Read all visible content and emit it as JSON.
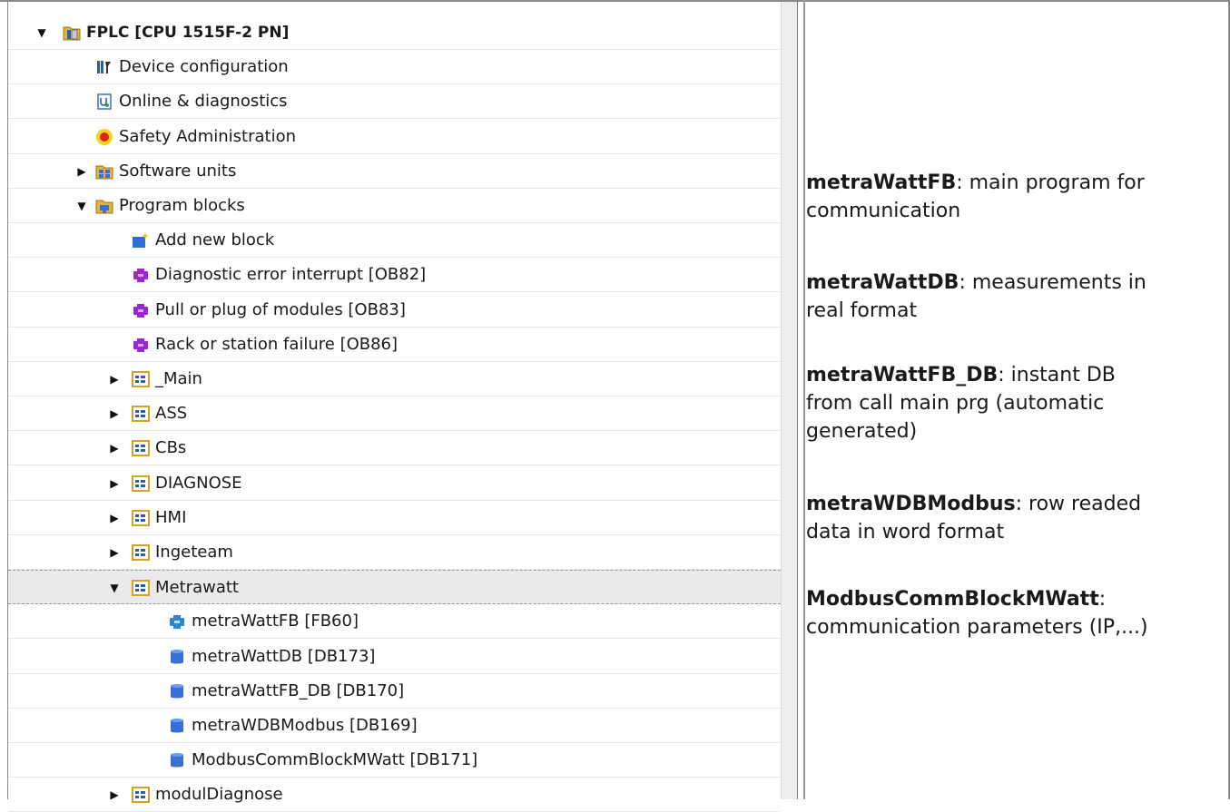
{
  "tree": {
    "items": [
      {
        "label": "FPLC [CPU 1515F-2 PN]",
        "icon": "plc-folder-icon",
        "arrow": "expanded"
      },
      {
        "label": "Device configuration",
        "icon": "device-configuration-icon",
        "arrow": "none"
      },
      {
        "label": "Online & diagnostics",
        "icon": "online-diagnostics-icon",
        "arrow": "none"
      },
      {
        "label": "Safety Administration",
        "icon": "safety-administration-icon",
        "arrow": "none"
      },
      {
        "label": "Software units",
        "icon": "software-units-icon",
        "arrow": "collapsed"
      },
      {
        "label": "Program blocks",
        "icon": "program-blocks-folder-icon",
        "arrow": "expanded"
      },
      {
        "label": "Add new block",
        "icon": "add-new-block-icon",
        "arrow": "none"
      },
      {
        "label": "Diagnostic error interrupt [OB82]",
        "icon": "ob-block-icon",
        "arrow": "none"
      },
      {
        "label": "Pull or plug of modules [OB83]",
        "icon": "ob-block-icon",
        "arrow": "none"
      },
      {
        "label": "Rack or station failure [OB86]",
        "icon": "ob-block-icon",
        "arrow": "none"
      },
      {
        "label": "_Main",
        "icon": "group-folder-icon",
        "arrow": "collapsed"
      },
      {
        "label": "ASS",
        "icon": "group-folder-icon",
        "arrow": "collapsed"
      },
      {
        "label": "CBs",
        "icon": "group-folder-icon",
        "arrow": "collapsed"
      },
      {
        "label": "DIAGNOSE",
        "icon": "group-folder-icon",
        "arrow": "collapsed"
      },
      {
        "label": "HMI",
        "icon": "group-folder-icon",
        "arrow": "collapsed"
      },
      {
        "label": "Ingeteam",
        "icon": "group-folder-icon",
        "arrow": "collapsed"
      },
      {
        "label": "Metrawatt",
        "icon": "group-folder-icon",
        "arrow": "expanded"
      },
      {
        "label": "metraWattFB [FB60]",
        "icon": "fb-block-icon",
        "arrow": "none"
      },
      {
        "label": "metraWattDB [DB173]",
        "icon": "db-block-icon",
        "arrow": "none"
      },
      {
        "label": "metraWattFB_DB [DB170]",
        "icon": "db-block-icon",
        "arrow": "none"
      },
      {
        "label": "metraWDBModbus [DB169]",
        "icon": "db-block-icon",
        "arrow": "none"
      },
      {
        "label": "ModbusCommBlockMWatt [DB171]",
        "icon": "db-block-icon",
        "arrow": "none"
      },
      {
        "label": "modulDiagnose",
        "icon": "group-folder-icon",
        "arrow": "collapsed"
      }
    ],
    "selected_label": "Metrawatt"
  },
  "notes": [
    {
      "name": "metraWattFB",
      "sep": ": ",
      "text_l1": "main program for",
      "text_l2": "communication"
    },
    {
      "name": "metraWattDB",
      "sep": ": ",
      "text_l1": "measurements in",
      "text_l2": "real format"
    },
    {
      "name": "metraWattFB_DB",
      "sep": ": ",
      "text_l1": "instant DB",
      "text_l2": "from call main prg (automatic",
      "text_l3": "generated)"
    },
    {
      "name": "metraWDBModbus",
      "sep": ": ",
      "text_l1": "row readed",
      "text_l2": "data in word format"
    },
    {
      "name": "ModbusCommBlockMWatt",
      "sep": ":",
      "text_l1": "",
      "text_l2": "communication parameters (IP,...)"
    }
  ],
  "colors": {
    "group_folder": "#d8a21c",
    "ob_block": "#9b27d4",
    "fb_block": "#2d86d9",
    "db_block": "#3a6fd8",
    "safety": "#e2231a"
  }
}
